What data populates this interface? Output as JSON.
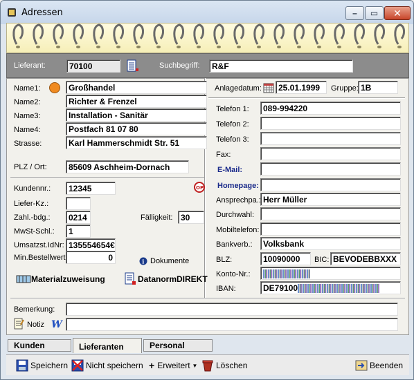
{
  "window": {
    "title": "Adressen"
  },
  "header": {
    "lieferant_label": "Lieferant:",
    "lieferant_value": "70100",
    "suchbegriff_label": "Suchbegriff:",
    "suchbegriff_value": "R&F"
  },
  "left": {
    "name1_label": "Name1:",
    "name1": "Großhandel",
    "name2_label": "Name2:",
    "name2": "Richter & Frenzel",
    "name3_label": "Name3:",
    "name3": "Installation - Sanitär",
    "name4_label": "Name4:",
    "name4": "Postfach 81 07 80",
    "strasse_label": "Strasse:",
    "strasse": "Karl Hammerschmidt Str. 51",
    "plz_label": "PLZ / Ort:",
    "plz_ort": "85609 Aschheim-Dornach",
    "kundennr_label": "Kundennr.:",
    "kundennr": "12345",
    "lieferkz_label": "Liefer-Kz.:",
    "lieferkz": "",
    "zahlbdg_label": "Zahl.-bdg.:",
    "zahlbdg": "0214",
    "faelligkeit_label": "Fälligkeit:",
    "faelligkeit": "30",
    "mwst_label": "MwSt-Schl.:",
    "mwst": "1",
    "ustid_label": "Umsatzst.IdNr:",
    "ustid": "135554654€",
    "minbest_label": "Min.Bestellwert:",
    "minbest": "0",
    "dokumente_label": "Dokumente",
    "materialzuweisung_label": "Materialzuweisung",
    "datanorm_label": "DatanormDIREKT"
  },
  "right": {
    "anlagedatum_label": "Anlagedatum:",
    "anlagedatum": "25.01.1999",
    "gruppe_label": "Gruppe:",
    "gruppe": "1B",
    "telefon1_label": "Telefon 1:",
    "telefon1": "089-994220",
    "telefon2_label": "Telefon 2:",
    "telefon2": "",
    "telefon3_label": "Telefon 3:",
    "telefon3": "",
    "fax_label": "Fax:",
    "fax": "",
    "email_label": "E-Mail:",
    "email": "",
    "homepage_label": "Homepage:",
    "homepage": "",
    "ansprechpartner_label": "Ansprechpa.:",
    "ansprechpartner": "Herr Müller",
    "durchwahl_label": "Durchwahl:",
    "durchwahl": "",
    "mobiltelefon_label": "Mobiltelefon:",
    "mobiltelefon": "",
    "bankverb_label": "Bankverb.:",
    "bankverb": "Volksbank",
    "blz_label": "BLZ:",
    "blz": "10090000",
    "bic_label": "BIC:",
    "bic": "BEVODEBBXXX",
    "kontonr_label": "Konto-Nr.:",
    "iban_label": "IBAN:",
    "iban_prefix": "DE79100"
  },
  "bottom": {
    "bemerkung_label": "Bemerkung:",
    "bemerkung": "",
    "notiz_label": "Notiz",
    "notiz": ""
  },
  "tabs": [
    "Kunden",
    "Lieferanten",
    "Personal"
  ],
  "toolbar": {
    "speichern": "Speichern",
    "nicht_speichern": "Nicht speichern",
    "erweitert": "Erweitert",
    "loeschen": "Löschen",
    "beenden": "Beenden"
  },
  "colors": {
    "accent_blue": "#1a2a8a",
    "status_orange": "#f08a20",
    "ring_paper": "#fffbe0"
  }
}
